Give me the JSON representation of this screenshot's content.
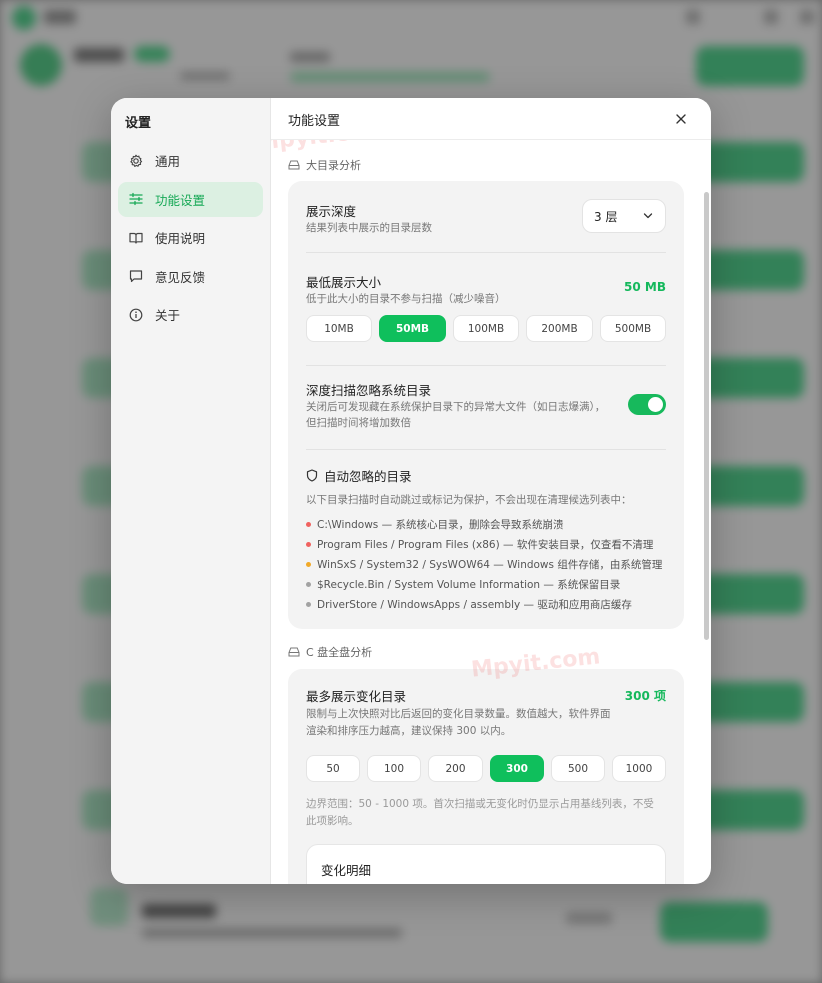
{
  "colors": {
    "accent": "#17b95c",
    "accent_light": "#dcf0e2",
    "dot_red": "#f0625f",
    "dot_orange": "#f1a928",
    "dot_gray": "#a2a2a2"
  },
  "watermark": "Mpyit.com",
  "sidebar": {
    "title": "设置",
    "items": [
      {
        "label": "通用",
        "icon": "gear-icon"
      },
      {
        "label": "功能设置",
        "icon": "sliders-icon",
        "active": true
      },
      {
        "label": "使用说明",
        "icon": "book-icon"
      },
      {
        "label": "意见反馈",
        "icon": "chat-icon"
      },
      {
        "label": "关于",
        "icon": "info-icon"
      }
    ]
  },
  "main": {
    "title": "功能设置",
    "section1": {
      "title": "大目录分析",
      "depth": {
        "title": "展示深度",
        "desc": "结果列表中展示的目录层数",
        "value": "3 层"
      },
      "min_size": {
        "title": "最低展示大小",
        "desc": "低于此大小的目录不参与扫描（减少噪音）",
        "value": "50 MB",
        "options": [
          "10MB",
          "50MB",
          "100MB",
          "200MB",
          "500MB"
        ],
        "selected": "50MB"
      },
      "deep_scan": {
        "title": "深度扫描忽略系统目录",
        "desc1": "关闭后可发现藏在系统保护目录下的异常大文件（如日志爆满），",
        "desc2": "但扫描时间将增加数倍",
        "enabled": true
      },
      "auto_ignore": {
        "title": "自动忽略的目录",
        "desc": "以下目录扫描时自动跳过或标记为保护，不会出现在清理候选列表中：",
        "items": [
          {
            "text": "C:\\Windows — 系统核心目录，删除会导致系统崩溃",
            "level": "red"
          },
          {
            "text": "Program Files / Program Files (x86) — 软件安装目录，仅查看不清理",
            "level": "red"
          },
          {
            "text": "WinSxS / System32 / SysWOW64 — Windows 组件存储，由系统管理",
            "level": "orange"
          },
          {
            "text": "$Recycle.Bin / System Volume Information — 系统保留目录",
            "level": "gray"
          },
          {
            "text": "DriverStore / WindowsApps / assembly — 驱动和应用商店缓存",
            "level": "gray"
          }
        ]
      }
    },
    "section2": {
      "title": "C 盘全盘分析",
      "max_changes": {
        "title": "最多展示变化目录",
        "desc1": "限制与上次快照对比后返回的变化目录数量。数值越大，软件界面",
        "desc2": "渲染和排序压力越高，建议保持 300 以内。",
        "value": "300 项",
        "options": [
          "50",
          "100",
          "200",
          "300",
          "500",
          "1000"
        ],
        "selected": "300",
        "note1": "边界范围：50 - 1000 项。首次扫描或无变化时仍显示占用基线列表，不受",
        "note2": "此项影响。"
      },
      "detail": {
        "title": "变化明细"
      }
    }
  }
}
